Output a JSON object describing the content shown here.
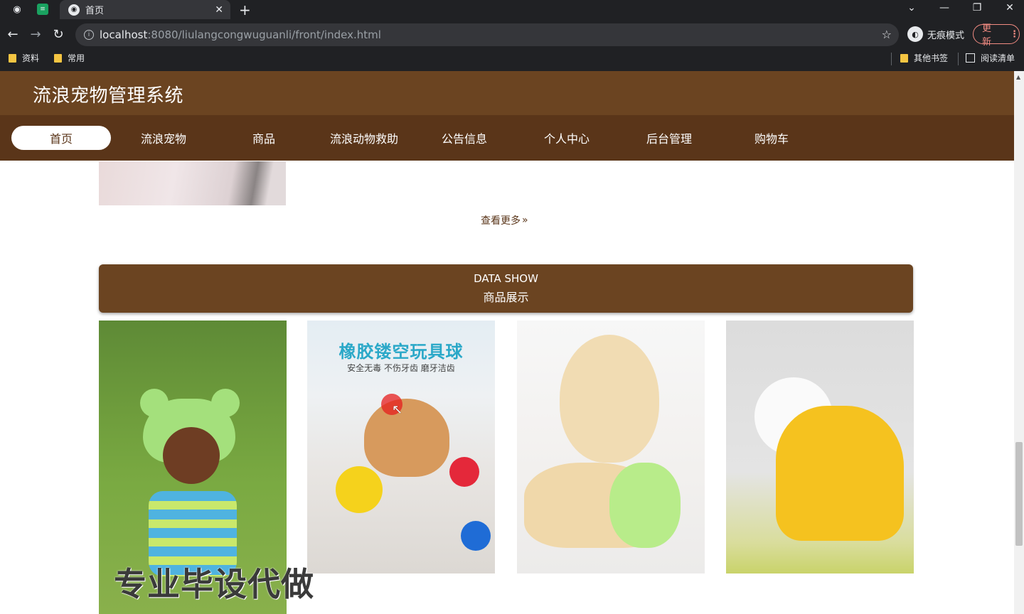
{
  "browser": {
    "tab_title": "首页",
    "url_host": "localhost",
    "url_rest": ":8080/liulangcongwuguanli/front/index.html",
    "incognito_label": "无痕模式",
    "update_label": "更新",
    "bookmarks": [
      "资料",
      "常用"
    ],
    "bookmarks_right": [
      "其他书签",
      "阅读清单"
    ]
  },
  "site": {
    "title": "流浪宠物管理系统",
    "nav": [
      "首页",
      "流浪宠物",
      "商品",
      "流浪动物救助",
      "公告信息",
      "个人中心",
      "后台管理",
      "购物车"
    ],
    "active_nav": "首页"
  },
  "content": {
    "more_label": "查看更多",
    "section_en": "DATA SHOW",
    "section_zh": "商品展示",
    "promo_title": "橡胶镂空玩具球",
    "promo_sub": "安全无毒  不伤牙齿  磨牙洁齿",
    "watermark": "专业毕设代做"
  },
  "colors": {
    "header": "#6b4421",
    "nav": "#5a3519",
    "accent_text": "#5a3519"
  }
}
